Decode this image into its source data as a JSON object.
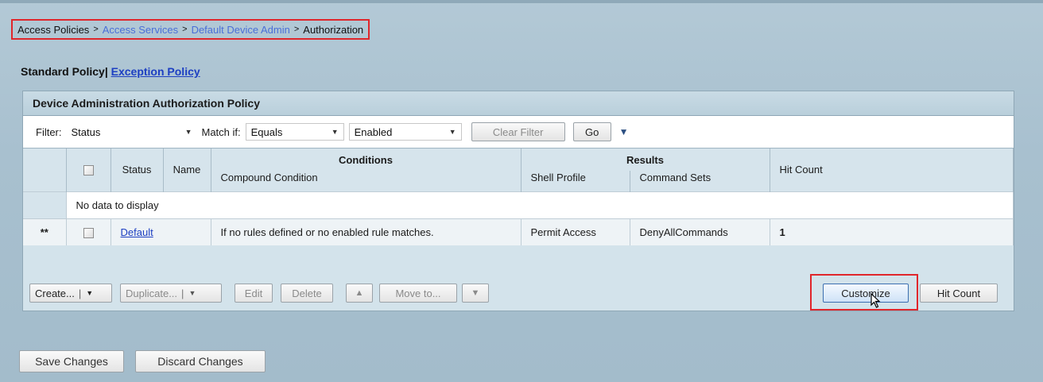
{
  "breadcrumb": {
    "items": [
      "Access Policies",
      "Access Services",
      "Default Device Admin",
      "Authorization"
    ],
    "separator": ">"
  },
  "policy_tabs": {
    "standard": "Standard Policy",
    "divider": "|",
    "exception": "Exception Policy"
  },
  "panel": {
    "title": "Device Administration Authorization Policy"
  },
  "filter": {
    "label": "Filter:",
    "field_value": "Status",
    "match_label": "Match if:",
    "match_value": "Equals",
    "value": "Enabled",
    "clear_label": "Clear Filter",
    "go_label": "Go",
    "menu_icon": "triangle-down-icon"
  },
  "table": {
    "columns": {
      "status": "Status",
      "name": "Name",
      "conditions_group": "Conditions",
      "compound_condition": "Compound Condition",
      "results_group": "Results",
      "shell_profile": "Shell Profile",
      "command_sets": "Command Sets",
      "hit_count": "Hit Count"
    },
    "empty_message": "No data to display",
    "default_row": {
      "marker": "**",
      "name": "Default",
      "condition": "If no rules defined or no enabled rule matches.",
      "shell_profile": "Permit Access",
      "command_sets": "DenyAllCommands",
      "hit_count": "1"
    }
  },
  "actions": {
    "create": "Create...",
    "duplicate": "Duplicate...",
    "edit": "Edit",
    "delete": "Delete",
    "move_to": "Move to...",
    "customize": "Customize",
    "hit_count": "Hit Count"
  },
  "footer": {
    "save": "Save Changes",
    "discard": "Discard Changes"
  },
  "colors": {
    "highlight_border": "#e0262b",
    "link": "#1d3fc2",
    "panel_bg": "#d3e3eb"
  }
}
